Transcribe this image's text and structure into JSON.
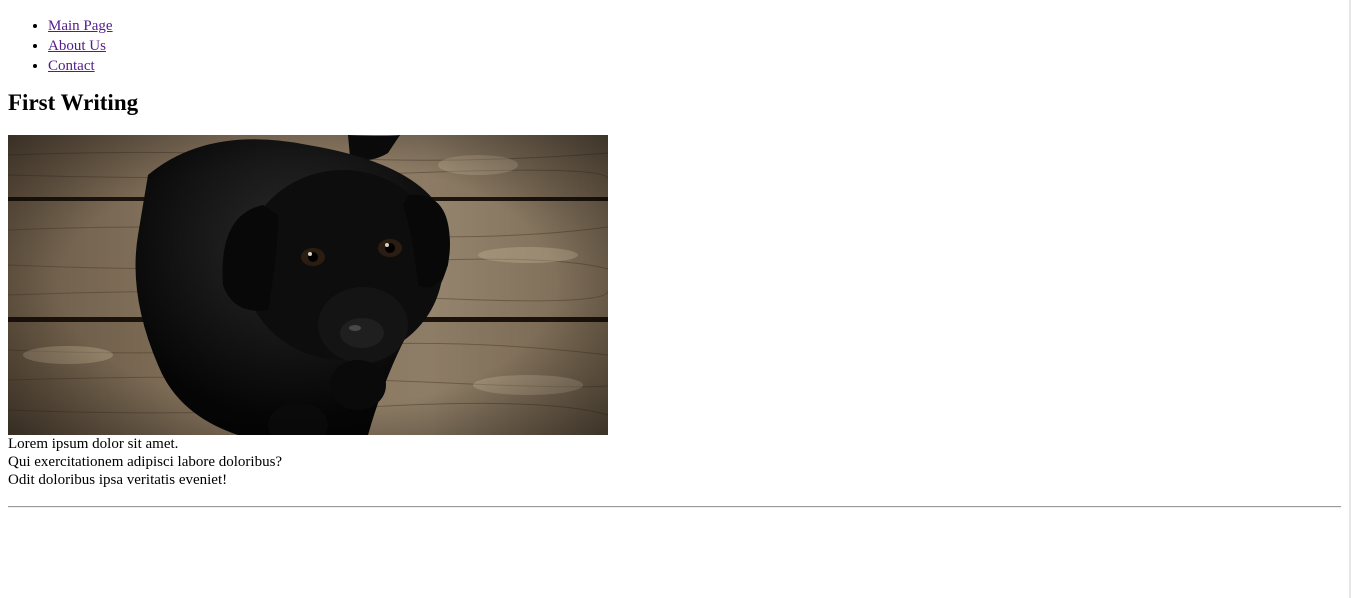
{
  "nav": {
    "items": [
      {
        "label": "Main Page"
      },
      {
        "label": "About Us"
      },
      {
        "label": "Contact"
      }
    ]
  },
  "article": {
    "title": "First Writing",
    "image": "black-puppy-on-wooden-floor",
    "paragraphs": [
      "Lorem ipsum dolor sit amet.",
      "Qui exercitationem adipisci labore doloribus?",
      "Odit doloribus ipsa veritatis eveniet!"
    ]
  },
  "colors": {
    "link_visited": "#551a8b",
    "text": "#000000",
    "background": "#ffffff"
  }
}
